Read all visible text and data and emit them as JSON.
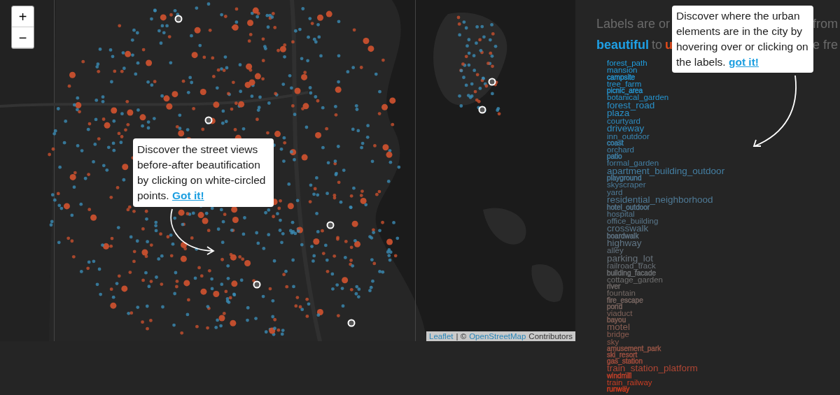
{
  "map": {
    "zoom_controls": [
      "+",
      "−"
    ],
    "tooltip": {
      "text": "Discover the street views before-after beautification by clicking on white-circled points.",
      "link": "Got it!"
    },
    "attribution": {
      "leaflet": "Leaflet",
      "separator": "| ©",
      "osm": "OpenStreetMap",
      "suffix": "Contributors"
    }
  },
  "panel": {
    "intro": {
      "line_1_left": "Labels are or",
      "line_1_right": "from",
      "beautiful": "beautiful",
      "to": "to",
      "ugly_start": "u",
      "line_2_right": "e fre"
    },
    "tooltip": {
      "text": "Discover where the urban elements are in the city by hovering over or clicking on the labels.",
      "link": "got it!"
    },
    "labels": [
      {
        "text": "forest_path",
        "kind": "medium",
        "color": "#1f9ee0"
      },
      {
        "text": "mansion",
        "kind": "medium",
        "color": "#1f9ee0"
      },
      {
        "text": "campsite",
        "kind": "small",
        "color": "#2398d6"
      },
      {
        "text": "tree_farm",
        "kind": "medium",
        "color": "#2398d6"
      },
      {
        "text": "picnic_area",
        "kind": "small",
        "color": "#2594cf"
      },
      {
        "text": "botanical_garden",
        "kind": "medium",
        "color": "#2594cf"
      },
      {
        "text": "forest_road",
        "kind": "large",
        "color": "#2990c8"
      },
      {
        "text": "plaza",
        "kind": "large",
        "color": "#2990c8"
      },
      {
        "text": "courtyard",
        "kind": "medium",
        "color": "#2e8cc0"
      },
      {
        "text": "driveway",
        "kind": "large",
        "color": "#2e8cc0"
      },
      {
        "text": "inn_outdoor",
        "kind": "medium",
        "color": "#3a86b2"
      },
      {
        "text": "coast",
        "kind": "small",
        "color": "#3a86b2"
      },
      {
        "text": "orchard",
        "kind": "medium",
        "color": "#3f82aa"
      },
      {
        "text": "patio",
        "kind": "small",
        "color": "#3f82aa"
      },
      {
        "text": "formal_garden",
        "kind": "medium",
        "color": "#447fa3"
      },
      {
        "text": "apartment_building_outdoor",
        "kind": "large",
        "color": "#447fa3"
      },
      {
        "text": "playground",
        "kind": "small",
        "color": "#4a7c9c"
      },
      {
        "text": "skyscraper",
        "kind": "medium",
        "color": "#4a7c9c"
      },
      {
        "text": "yard",
        "kind": "medium",
        "color": "#4f7a96"
      },
      {
        "text": "residential_neighborhood",
        "kind": "large",
        "color": "#4f7a96"
      },
      {
        "text": "hotel_outdoor",
        "kind": "small",
        "color": "#557890"
      },
      {
        "text": "hospital",
        "kind": "medium",
        "color": "#557890"
      },
      {
        "text": "office_building",
        "kind": "medium",
        "color": "#5a778a"
      },
      {
        "text": "crosswalk",
        "kind": "large",
        "color": "#5a778a"
      },
      {
        "text": "boardwalk",
        "kind": "small",
        "color": "#607585"
      },
      {
        "text": "highway",
        "kind": "large",
        "color": "#607585"
      },
      {
        "text": "alley",
        "kind": "medium",
        "color": "#657480"
      },
      {
        "text": "parking_lot",
        "kind": "large",
        "color": "#68737c"
      },
      {
        "text": "railroad_track",
        "kind": "medium",
        "color": "#6b7279"
      },
      {
        "text": "building_facade",
        "kind": "small",
        "color": "#6e7174"
      },
      {
        "text": "cottage_garden",
        "kind": "medium",
        "color": "#707070"
      },
      {
        "text": "river",
        "kind": "small",
        "color": "#726c6a"
      },
      {
        "text": "fountain",
        "kind": "medium",
        "color": "#746a66"
      },
      {
        "text": "fire_escape",
        "kind": "small",
        "color": "#786762"
      },
      {
        "text": "pond",
        "kind": "small",
        "color": "#7b655f"
      },
      {
        "text": "viaduct",
        "kind": "medium",
        "color": "#7f635b"
      },
      {
        "text": "bayou",
        "kind": "small",
        "color": "#836056"
      },
      {
        "text": "motel",
        "kind": "large",
        "color": "#875e53"
      },
      {
        "text": "bridge",
        "kind": "medium",
        "color": "#8b5c50"
      },
      {
        "text": "sky",
        "kind": "medium",
        "color": "#8f5a4c"
      },
      {
        "text": "amusement_park",
        "kind": "small",
        "color": "#955546"
      },
      {
        "text": "ski_resort",
        "kind": "small",
        "color": "#9c5042"
      },
      {
        "text": "gas_station",
        "kind": "small",
        "color": "#a44c3c"
      },
      {
        "text": "train_station_platform",
        "kind": "large",
        "color": "#b04634"
      },
      {
        "text": "windmill",
        "kind": "small",
        "color": "#c0402a"
      },
      {
        "text": "train_railway",
        "kind": "medium",
        "color": "#cc3e24"
      },
      {
        "text": "runway",
        "kind": "small",
        "color": "#d63c1e"
      }
    ]
  }
}
